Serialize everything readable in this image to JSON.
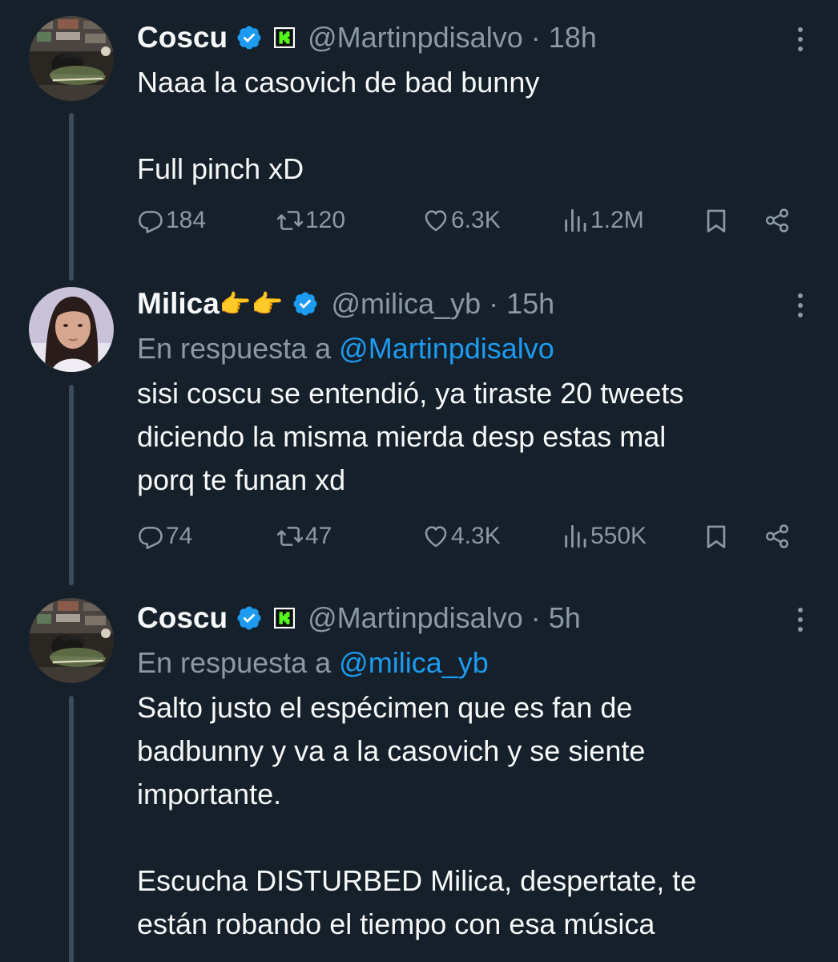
{
  "tweets": [
    {
      "name": "Coscu",
      "name_suffix": "",
      "handle_time": "@Martinpdisalvo · 18h",
      "reply_prefix": "",
      "reply_to": "",
      "text": "Naaa la casovich de bad bunny\n\nFull pinch xD",
      "stats": {
        "replies": "184",
        "retweets": "120",
        "likes": "6.3K",
        "views": "1.2M"
      }
    },
    {
      "name": "Milica",
      "name_suffix": "👉👉",
      "handle_time": "@milica_yb · 15h",
      "reply_prefix": "En respuesta a ",
      "reply_to": "@Martinpdisalvo",
      "text": "sisi coscu se entendió, ya tiraste 20 tweets\ndiciendo la misma mierda desp estas mal\nporq te funan xd",
      "stats": {
        "replies": "74",
        "retweets": "47",
        "likes": "4.3K",
        "views": "550K"
      }
    },
    {
      "name": "Coscu",
      "name_suffix": "",
      "handle_time": "@Martinpdisalvo · 5h",
      "reply_prefix": "En respuesta a ",
      "reply_to": "@milica_yb",
      "text": "Salto justo el espécimen que es fan de\nbadbunny y va a la casovich y se siente\nimportante.\n\nEscucha DISTURBED Milica, despertate, te\nestán robando el tiempo con esa música",
      "stats": {}
    }
  ],
  "colors": {
    "background": "#15202b",
    "text": "#f7f9f9",
    "secondary": "#8b98a5",
    "link": "#1d9bf0",
    "verified": "#1d9bf0",
    "kick": "#53fc18",
    "thread_line": "#3d4c5b"
  },
  "icons": [
    "verified-badge-icon",
    "kick-badge-icon",
    "more-options-icon",
    "reply-icon",
    "retweet-icon",
    "like-icon",
    "views-icon",
    "bookmark-icon",
    "share-icon"
  ]
}
